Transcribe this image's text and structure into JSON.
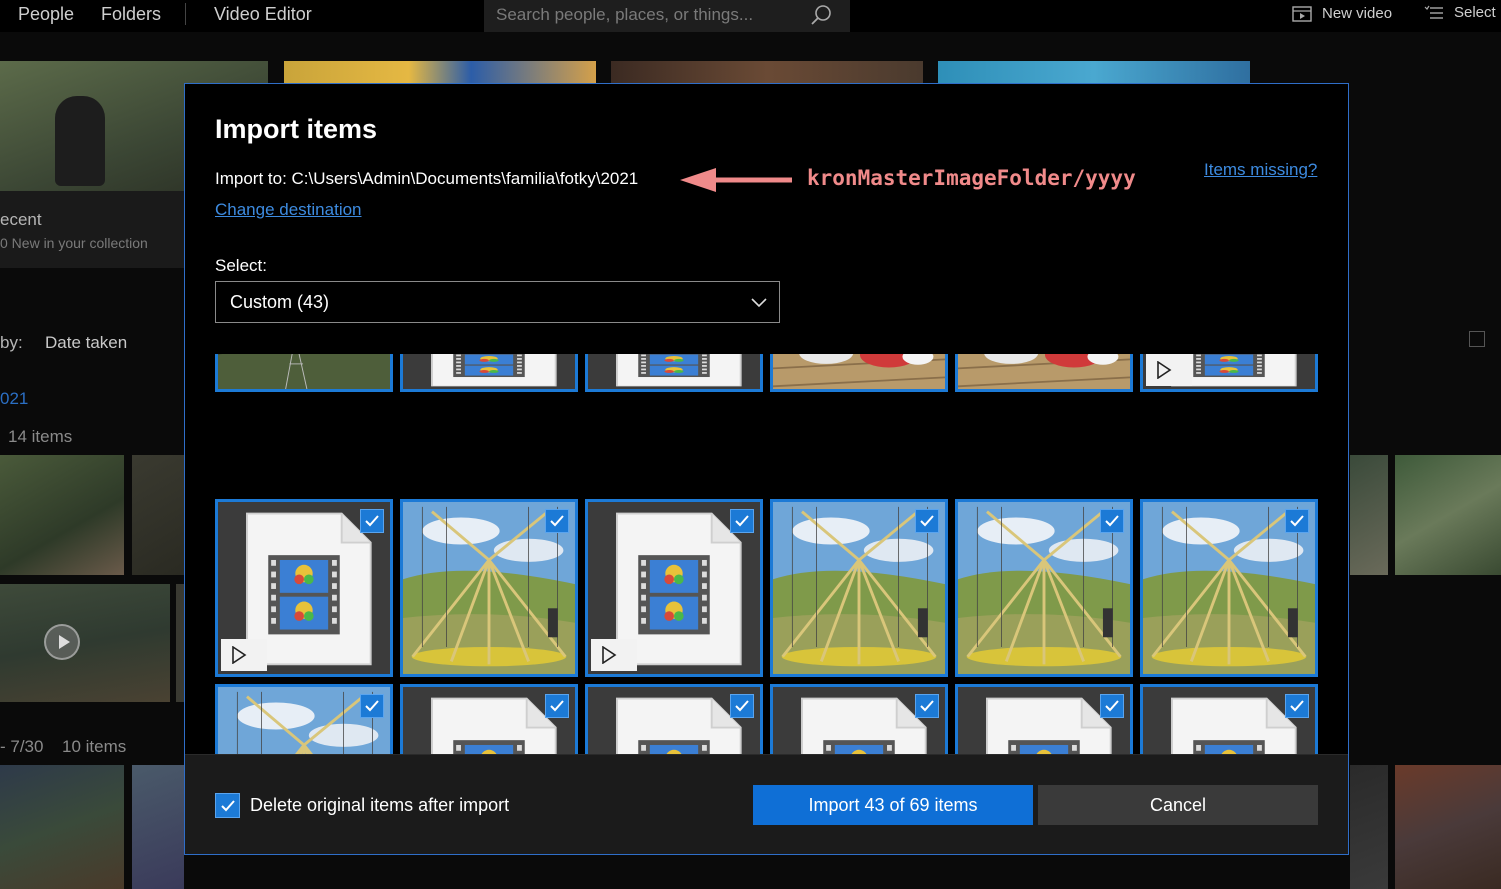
{
  "topbar": {
    "nav": [
      "People",
      "Folders",
      "Video Editor"
    ],
    "search_placeholder": "Search people, places, or things...",
    "new_video": "New video",
    "select": "Select"
  },
  "background": {
    "recent_title": "ecent",
    "recent_sub": "0 New in your collection",
    "sort_prefix": "by:",
    "sort_value": "Date taken",
    "year_link": "021",
    "group1_count": "14 items",
    "group2_date": "- 7/30",
    "group2_count": "10 items"
  },
  "dialog": {
    "title": "Import items",
    "import_to": "Import to:  C:\\Users\\Admin\\Documents\\familia\\fotky\\2021",
    "annotation": "kronMasterImageFolder/yyyy",
    "items_missing": "Items missing?",
    "change_destination": "Change destination",
    "select_label": "Select:",
    "select_value": "Custom (43)",
    "footer": {
      "delete_label": "Delete original items after import",
      "delete_checked": true,
      "import_button": "Import 43 of 69 items",
      "cancel_button": "Cancel"
    }
  },
  "grid": {
    "rows": [
      [
        "landscape",
        "video-file",
        "video-file",
        "kids-floor",
        "kids-floor",
        "video-file"
      ],
      [
        "video-file",
        "playground",
        "video-file",
        "playground",
        "playground",
        "playground"
      ],
      [
        "playground",
        "video-file",
        "video-file",
        "video-file",
        "video-file",
        "video-file"
      ]
    ],
    "selected": [
      [
        true,
        true,
        true,
        true,
        true,
        true
      ],
      [
        true,
        true,
        true,
        true,
        true,
        true
      ],
      [
        true,
        true,
        true,
        true,
        true,
        true
      ]
    ],
    "video_badge": [
      [
        false,
        false,
        false,
        false,
        false,
        true
      ],
      [
        true,
        false,
        true,
        false,
        false,
        false
      ],
      [
        false,
        false,
        false,
        false,
        false,
        false
      ]
    ]
  },
  "colors": {
    "accent": "#1c7ad6",
    "link": "#3d8be0",
    "annotation": "#f08a8a",
    "dialog_border": "#2f6ec9"
  }
}
